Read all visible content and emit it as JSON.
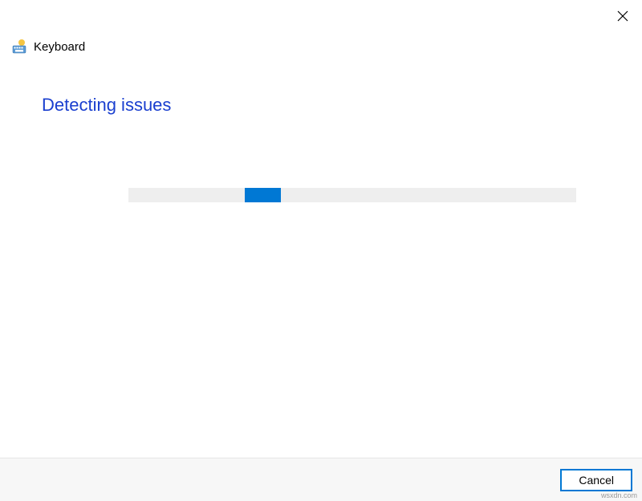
{
  "header": {
    "title": "Keyboard",
    "icon": "keyboard-icon"
  },
  "content": {
    "status_heading": "Detecting issues"
  },
  "progress": {
    "fill_left_percent": 26,
    "fill_width_percent": 8,
    "track_color": "#eeeeee",
    "fill_color": "#0078d4"
  },
  "footer": {
    "cancel_label": "Cancel"
  },
  "watermark": "wsxdn.com"
}
